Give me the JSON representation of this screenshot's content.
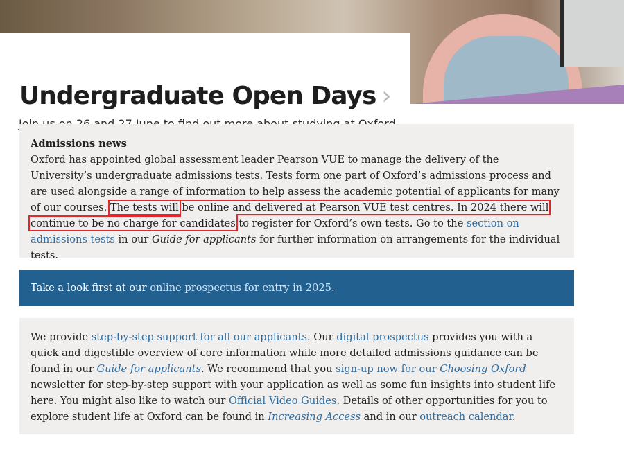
{
  "hero": {
    "title": "Undergraduate Open Days",
    "chevron": "›",
    "subtitle": "Join us on 26 and 27 June to find out more about studying at Oxford"
  },
  "admissions_news": {
    "heading": "Admissions news",
    "p1": "Oxford has appointed global assessment leader Pearson VUE to manage the delivery of the University’s undergraduate admissions tests. Tests form one part of Oxford’s admissions process and are used alongside a range of information to help assess the academic potential of applicants for many of our courses.",
    "highlight_1": "The tests will",
    "highlight_2": "be online and delivered at Pearson VUE test centres. In 2024 there will continue to be no charge for candidates",
    "p2_start": "to register for Oxford’s own tests. Go to the ",
    "link_tests": "section on admissions tests",
    "p2_mid": " in our ",
    "guide_italic": "Guide for applicants",
    "p2_end": " for further information on arrangements for the individual tests."
  },
  "prospectus_box": {
    "text": "Take a look first at our ",
    "link": "online prospectus for entry in 2025",
    "end": "."
  },
  "support_box": {
    "t1": "We provide ",
    "link_support": "step-by-step support for all our applicants",
    "t2": ". Our ",
    "link_digital": "digital prospectus",
    "t3": " provides you with a quick and digestible overview of core information while more detailed admissions guidance can be found in our ",
    "link_guide": "Guide for applicants",
    "t4": ".  We recommend that you ",
    "link_signup_start": "sign-up now for our ",
    "link_signup_italic": "Choosing Oxford",
    "t5": " newsletter for step-by-step support with your application as well as some fun insights into student life here.  You might also like to watch our ",
    "link_video": "Official Video Guides",
    "t6": ". Details of other opportunities for you to explore student life at Oxford can be found in ",
    "link_increasing": "Increasing Access",
    "t7": " and in our ",
    "link_outreach": "outreach calendar",
    "t8": "."
  },
  "colors": {
    "accent_blue": "#22608f",
    "link_blue": "#2f6b9e",
    "highlight_red": "#e0282d",
    "box_grey": "#f0efed"
  }
}
